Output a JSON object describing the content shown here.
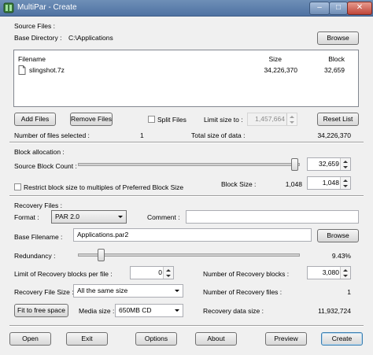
{
  "window": {
    "title": "MultiPar - Create"
  },
  "source": {
    "section_label": "Source Files :",
    "base_dir_label": "Base Directory :",
    "base_dir_value": "C:\\Applications",
    "browse_label": "Browse",
    "list": {
      "col_filename": "Filename",
      "col_size": "Size",
      "col_block": "Block",
      "rows": [
        {
          "filename": "slingshot.7z",
          "size": "34,226,370",
          "block": "32,659"
        }
      ]
    },
    "add_files": "Add Files",
    "remove_files": "Remove Files",
    "split_files": "Split Files",
    "limit_size_label": "Limit size to :",
    "limit_size_value": "1,457,664",
    "reset_list": "Reset List",
    "num_files_label": "Number of files selected :",
    "num_files_value": "1",
    "total_size_label": "Total size of data :",
    "total_size_value": "34,226,370"
  },
  "block": {
    "section_label": "Block allocation :",
    "source_block_count_label": "Source Block Count :",
    "source_block_count_value": "32,659",
    "restrict_label": "Restrict block size to multiples of Preferred Block Size",
    "block_size_label": "Block Size :",
    "block_size_text": "1,048",
    "block_size_value": "1,048"
  },
  "recovery": {
    "section_label": "Recovery Files :",
    "format_label": "Format :",
    "format_value": "PAR 2.0",
    "comment_label": "Comment :",
    "comment_value": "",
    "base_filename_label": "Base Filename :",
    "base_filename_value": "Applications.par2",
    "browse_label": "Browse",
    "redundancy_label": "Redundancy :",
    "redundancy_value": "9.43%",
    "limit_blocks_label": "Limit of Recovery blocks per file :",
    "limit_blocks_value": "0",
    "num_recovery_blocks_label": "Number of Recovery blocks :",
    "num_recovery_blocks_value": "3,080",
    "file_size_label": "Recovery File Size :",
    "file_size_value": "All the same size",
    "num_recovery_files_label": "Number of Recovery files :",
    "num_recovery_files_value": "1",
    "fit_button": "Fit to free space",
    "media_size_label": "Media size :",
    "media_size_value": "650MB CD",
    "data_size_label": "Recovery data size :",
    "data_size_value": "11,932,724"
  },
  "buttons": {
    "open": "Open",
    "exit": "Exit",
    "options": "Options",
    "about": "About",
    "preview": "Preview",
    "create": "Create"
  }
}
